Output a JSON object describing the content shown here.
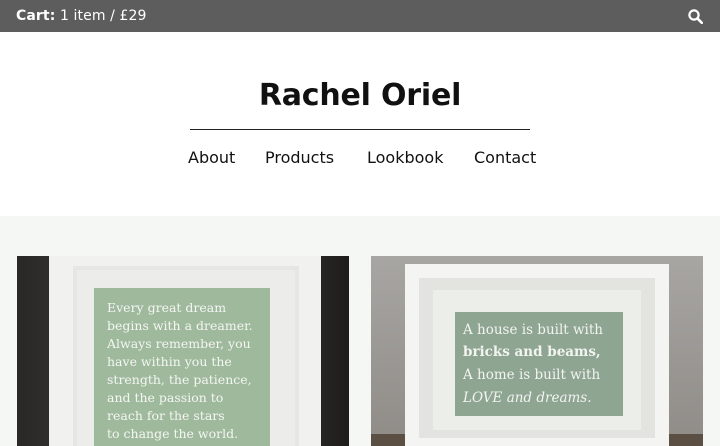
{
  "topbar": {
    "cart_label": "Cart:",
    "cart_summary": "1 item / £29",
    "search_icon": "search-icon"
  },
  "header": {
    "site_title": "Rachel Oriel"
  },
  "nav": {
    "items": [
      {
        "label": "About"
      },
      {
        "label": "Products"
      },
      {
        "label": "Lookbook"
      },
      {
        "label": "Contact"
      }
    ]
  },
  "products": [
    {
      "quote_lines": [
        "Every great dream",
        "begins with a dreamer.",
        "Always remember, you",
        "have within you the",
        "strength, the patience,",
        "and the passion to",
        "reach for the stars",
        "to change the world."
      ]
    },
    {
      "quote_lines": [
        "A house is built with",
        "bricks and beams,",
        "A home is built with",
        "LOVE and dreams."
      ]
    }
  ],
  "colors": {
    "topbar": "#5d5d5d",
    "content_bg": "#f5f7f5",
    "print_green": "#9fb99d"
  }
}
